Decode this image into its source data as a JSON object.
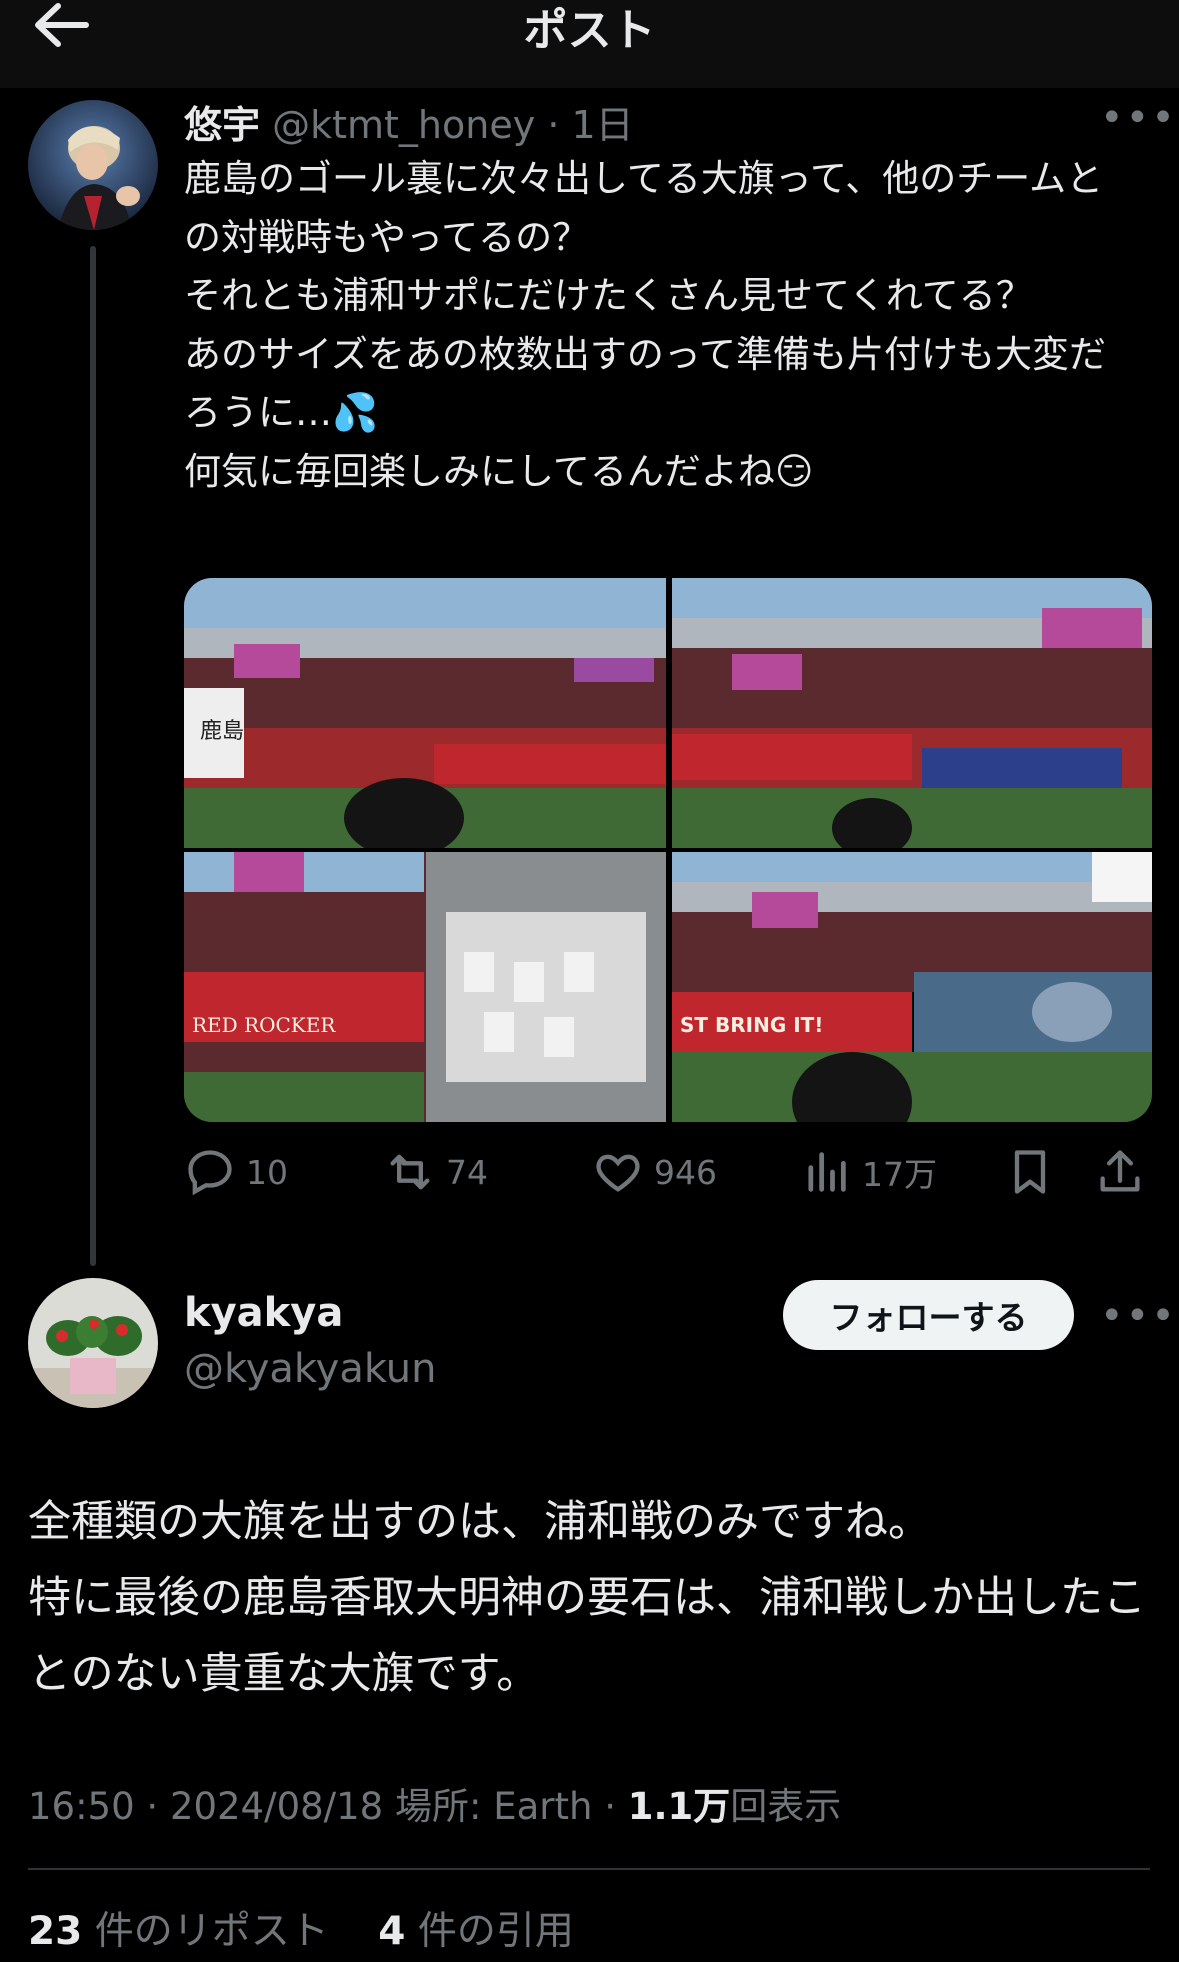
{
  "header": {
    "title": "ポスト"
  },
  "original_post": {
    "display_name": "悠宇",
    "handle": "@ktmt_honey",
    "separator": "·",
    "time_ago": "1日",
    "text": "鹿島のゴール裏に次々出してる大旗って、他のチームとの対戦時もやってるの？\nそれとも浦和サポにだけたくさん見せてくれてる？\nあのサイズをあの枚数出すのって準備も片付けも大変だろうに…💦\n何気に毎回楽しみにしてるんだよね😏",
    "metrics": {
      "replies": "10",
      "reposts": "74",
      "likes": "946",
      "views": "17万"
    },
    "media_banner_texts": [
      "鹿島",
      "ST BRING IT!",
      "RED ROCKER"
    ]
  },
  "reply_post": {
    "display_name": "kyakya",
    "handle": "@kyakyakun",
    "follow_label": "フォローする",
    "text": "全種類の大旗を出すのは、浦和戦のみですね。\n特に最後の鹿島香取大明神の要石は、浦和戦しか出したことのない貴重な大旗です。",
    "time": "16:50",
    "sep1": "·",
    "date": "2024/08/18",
    "location": "場所: Earth",
    "sep2": "·",
    "views_count": "1.1万",
    "views_label": "回表示",
    "reposts_count": "23",
    "reposts_label": "件のリポスト",
    "quotes_count": "4",
    "quotes_label": "件の引用"
  },
  "colors": {
    "background": "#000000",
    "text": "#e7e9ea",
    "muted": "#71767b",
    "divider": "#2f3336",
    "follow_bg": "#eff3f4",
    "stadium_red": "#c0262d"
  }
}
